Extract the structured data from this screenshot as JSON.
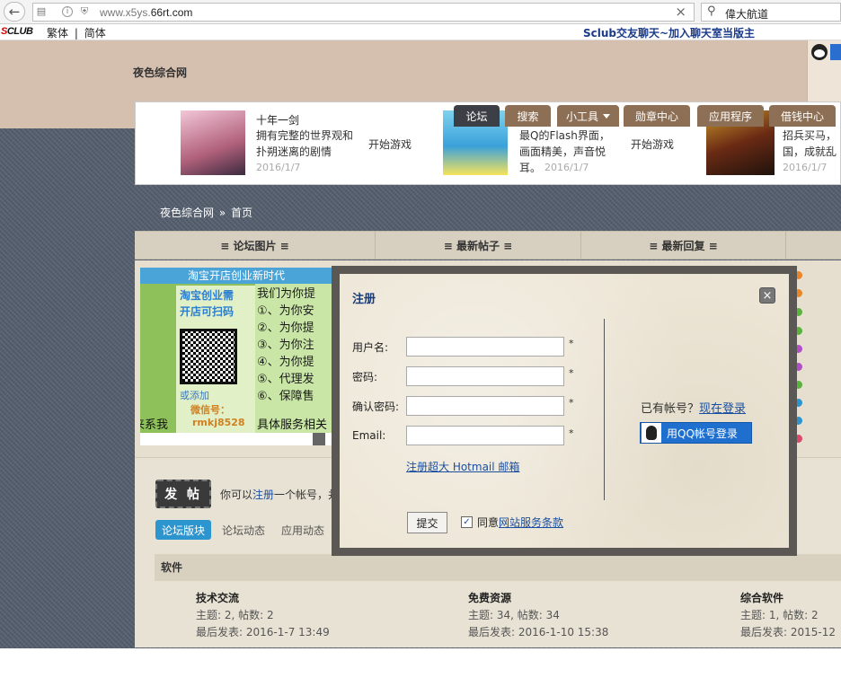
{
  "browser": {
    "url_prefix": "www.x5ys.",
    "url_domain": "66rt.com",
    "search_text": "偉大航道"
  },
  "topbar": {
    "logo_s": "S",
    "logo_rest": "CLUB",
    "lang_trad": "繁体",
    "lang_sep": "|",
    "lang_simp": "简体",
    "chat_link": "Sclub交友聊天~加入聊天室当版主"
  },
  "site": {
    "title": "夜色综合网"
  },
  "games": [
    {
      "name": "十年一剑",
      "desc1": "拥有完整的世界观和",
      "desc2": "扑朔迷离的剧情",
      "play": "开始游戏",
      "date": "2016/1/7"
    },
    {
      "name": "",
      "desc1": "最Q的Flash界面，",
      "desc2": "画面精美，声音悦",
      "desc3": "耳。",
      "play": "开始游戏",
      "date": "2016/1/7"
    },
    {
      "name": "",
      "desc1": "招兵买马，",
      "desc2": "国，成就乱",
      "date": "2016/1/7"
    }
  ],
  "nav": {
    "items": [
      "论坛",
      "搜索",
      "小工具",
      "勋章中心",
      "应用程序",
      "借钱中心"
    ]
  },
  "breadcrumb": {
    "home": "夜色综合网",
    "sep": "»",
    "current": "首页"
  },
  "sections": [
    "≡ 论坛图片 ≡",
    "≡ 最新帖子 ≡",
    "≡ 最新回复 ≡"
  ],
  "ad": {
    "top": "淘宝开店创业新时代",
    "left_title1": "淘宝创业需",
    "left_title2": "开店可扫码",
    "left_add": "或添加",
    "left_wx": "微信号：",
    "left_id": "rmkj8528",
    "right_lines": [
      "我们为你提",
      "①、为你安",
      "②、为你提",
      "③、为你注",
      "④、为你提",
      "⑤、代理发",
      "⑥、保障售"
    ],
    "bottom_left": "来系我",
    "bottom_right": "具体服务相关"
  },
  "post": {
    "button": "发 帖",
    "hint_prefix": "你可以",
    "hint_link": "注册",
    "hint_suffix": "一个帐号，并"
  },
  "tabs": [
    "论坛版块",
    "论坛动态",
    "应用动态"
  ],
  "category": "软件",
  "forums": [
    {
      "name": "技术交流",
      "stats": "主题: 2, 帖数: 2",
      "last": "最后发表: 2016-1-7 13:49"
    },
    {
      "name": "免费资源",
      "stats": "主题: 34, 帖数: 34",
      "last": "最后发表: 2016-1-10 15:38"
    },
    {
      "name": "综合软件",
      "stats": "主题: 1, 帖数: 2",
      "last": "最后发表: 2015-12"
    }
  ],
  "dialog": {
    "title": "注册",
    "close": "×",
    "username_label": "用户名:",
    "password_label": "密码:",
    "confirm_label": "确认密码:",
    "email_label": "Email:",
    "star": "*",
    "hotmail": "注册超大 Hotmail 邮箱",
    "have_account": "已有帐号？",
    "login_now": "现在登录",
    "qq_login": "用QQ帐号登录",
    "submit": "提交",
    "agree_prefix": "同意",
    "agree_link": "网站服务条款",
    "check_mark": "✓"
  },
  "colors": {
    "accent_blue": "#2c95cf",
    "nav_brown": "#8c6f55",
    "qq_blue": "#1f6fcf"
  }
}
